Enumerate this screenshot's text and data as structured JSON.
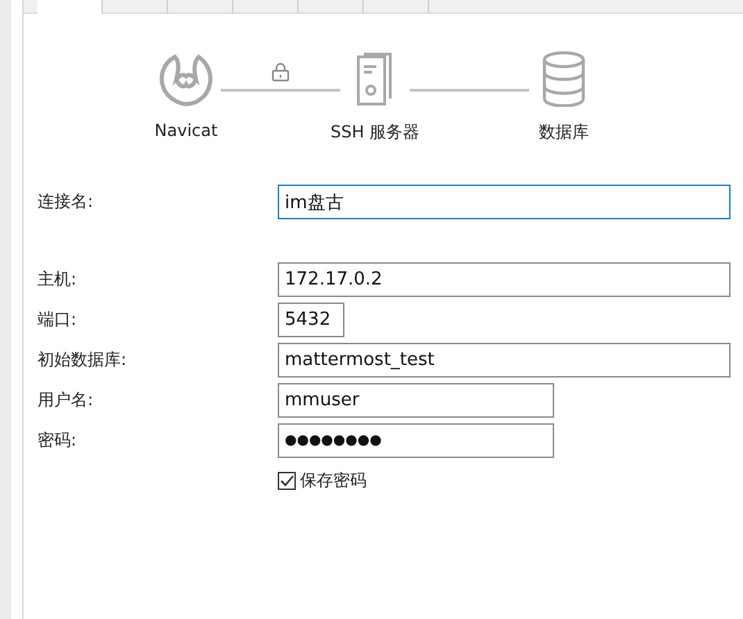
{
  "tabs": [
    {
      "selected": true
    },
    {
      "selected": false
    },
    {
      "selected": false
    },
    {
      "selected": false
    },
    {
      "selected": false
    },
    {
      "selected": false
    }
  ],
  "diagram": {
    "nodes": [
      "Navicat",
      "SSH 服务器",
      "数据库"
    ]
  },
  "form": {
    "fields": [
      {
        "label": "连接名:",
        "value": "im盘古",
        "focused": true,
        "kind": "wide"
      },
      {
        "label": "主机:",
        "value": "172.17.0.2",
        "focused": false,
        "kind": "wide"
      },
      {
        "label": "端口:",
        "value": "5432",
        "focused": false,
        "kind": "short"
      },
      {
        "label": "初始数据库:",
        "value": "mattermost_test",
        "focused": false,
        "kind": "wide"
      },
      {
        "label": "用户名:",
        "value": "mmuser",
        "focused": false,
        "kind": "medium"
      },
      {
        "label": "密码:",
        "value": "●●●●●●●●",
        "focused": false,
        "kind": "secret"
      }
    ],
    "save_password": {
      "label": "保存密码",
      "checked": true
    }
  }
}
